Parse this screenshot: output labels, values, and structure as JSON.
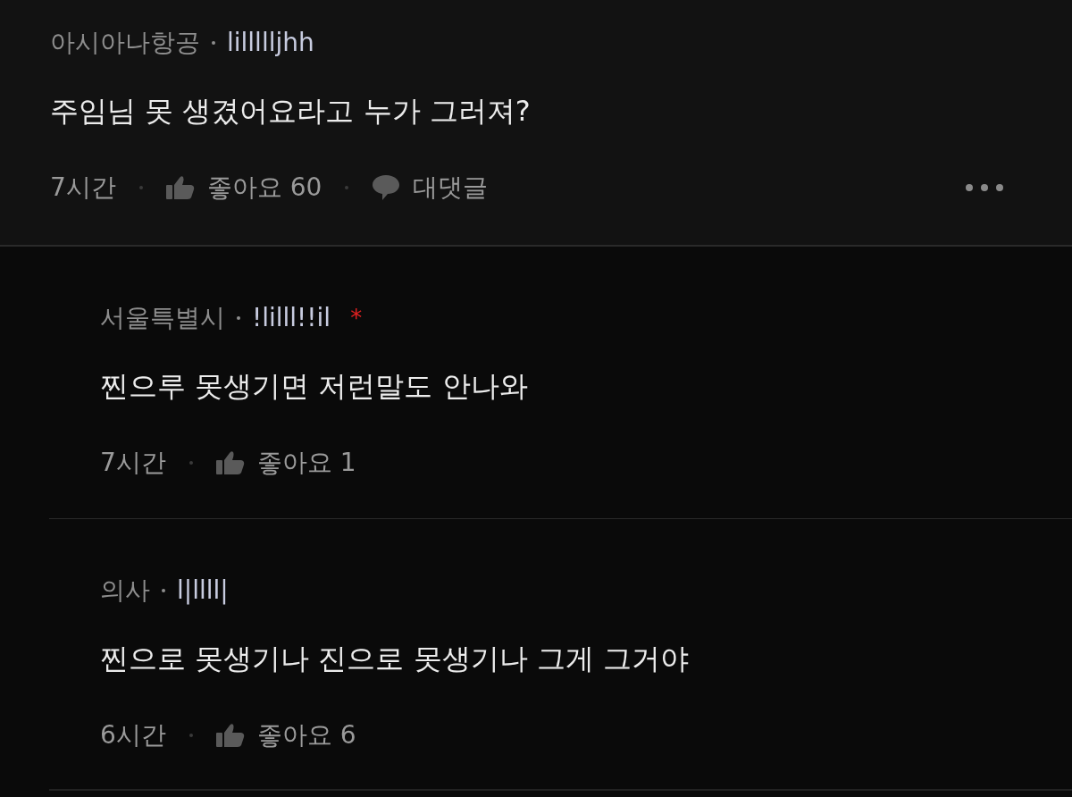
{
  "comments": [
    {
      "kind": "comment",
      "region": "아시아나항공",
      "nickname": "lillllljhh",
      "text": "주임님 못 생겼어요라고 누가 그러져?",
      "time": "7시간",
      "likes": "좋아요 60",
      "reply_label": "대댓글",
      "has_menu": true
    },
    {
      "kind": "reply",
      "region": "서울특별시",
      "nickname": "!lilll!!il",
      "mark": "*",
      "text": "찐으루 못생기면 저런말도 안나와",
      "time": "7시간",
      "likes": "좋아요 1"
    },
    {
      "kind": "reply",
      "region": "의사",
      "nickname": "l|llll|",
      "text": "찐으로 못생기나 진으로 못생기나 그게 그거야",
      "time": "6시간",
      "likes": "좋아요 6"
    }
  ]
}
